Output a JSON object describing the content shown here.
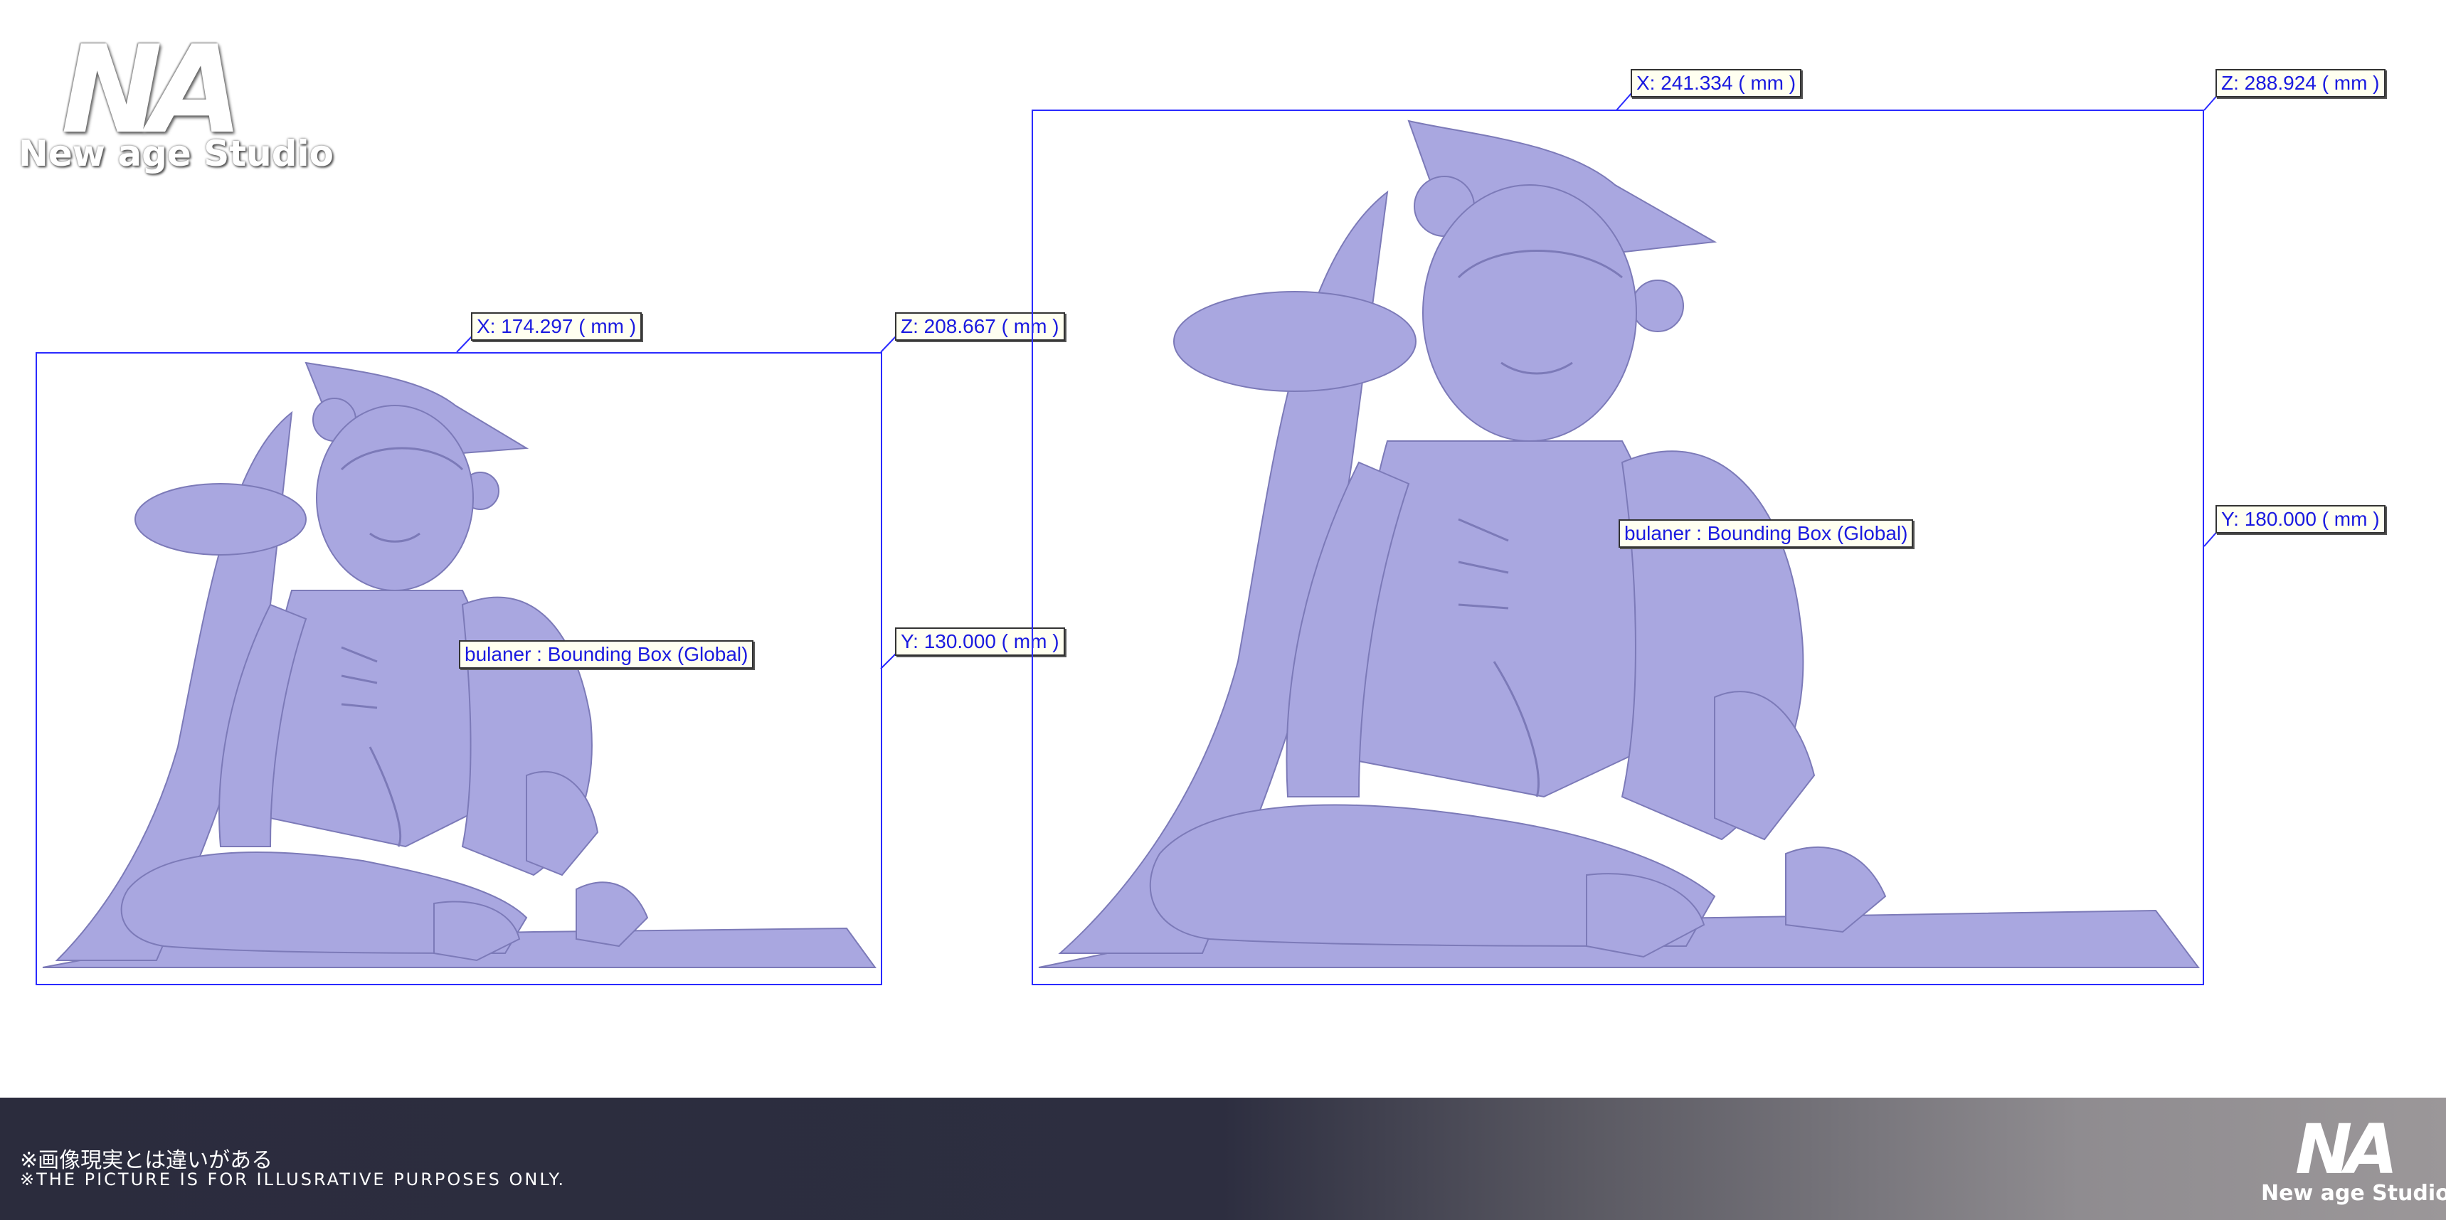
{
  "branding": {
    "logo_mark": "NA",
    "logo_text": "New age Studio"
  },
  "models": [
    {
      "x_label": "X: 174.297 ( mm )",
      "z_label": "Z: 208.667 ( mm )",
      "y_label": "Y: 130.000 ( mm )",
      "bbox_label": "bulaner : Bounding Box (Global)"
    },
    {
      "x_label": "X: 241.334 ( mm )",
      "z_label": "Z: 288.924 ( mm )",
      "y_label": "Y: 180.000 ( mm )",
      "bbox_label": "bulaner : Bounding Box (Global)"
    }
  ],
  "footer": {
    "disclaimer_jp": "※画像現実とは違いがある",
    "disclaimer_en": "※THE PICTURE IS FOR ILLUSRATIVE PURPOSES ONLY."
  },
  "colors": {
    "bbox_line": "#2a2aff",
    "label_text": "#1a1ae0",
    "model_fill": "#a9a7e0",
    "footer_dark": "#2b2c3d"
  }
}
